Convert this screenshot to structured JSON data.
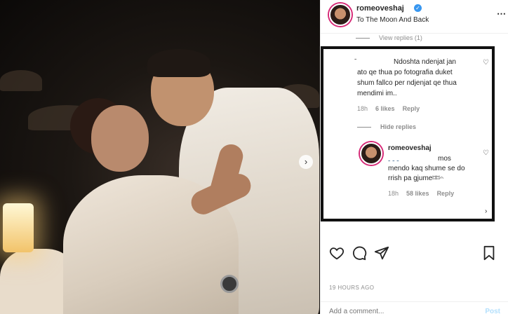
{
  "post": {
    "username": "romeoveshaj",
    "location": "To The Moon And Back",
    "more_icon": "more-icon"
  },
  "thread": {
    "view_replies": "View replies (1)"
  },
  "comment_1": {
    "mention": "ˍ",
    "text_lines": [
      "Ndoshta ndenjat jan",
      "ato qe thua po fotografia duket",
      "shum fallco per ndjenjat qe thua",
      "mendimi im.."
    ],
    "time": "18h",
    "likes": "6 likes",
    "reply": "Reply",
    "hide_replies": "Hide replies"
  },
  "reply_1": {
    "username": "romeoveshaj",
    "mention": "ˍ ˍ ˍ",
    "text_lines": [
      "mos",
      "mendo kaq shume se do",
      "rrish pa gjume⌑⌑𝄐"
    ],
    "time": "18h",
    "likes": "58 likes",
    "reply": "Reply"
  },
  "actions": {
    "like": "heart-icon",
    "comment": "comment-icon",
    "share": "share-icon",
    "save": "bookmark-icon"
  },
  "timestamp": "19 HOURS AGO",
  "add_comment": {
    "placeholder": "Add a comment...",
    "post_label": "Post"
  },
  "colors": {
    "accent_blue": "#3897f0",
    "muted": "#8e8e8e",
    "highlight_border": "#111111"
  }
}
